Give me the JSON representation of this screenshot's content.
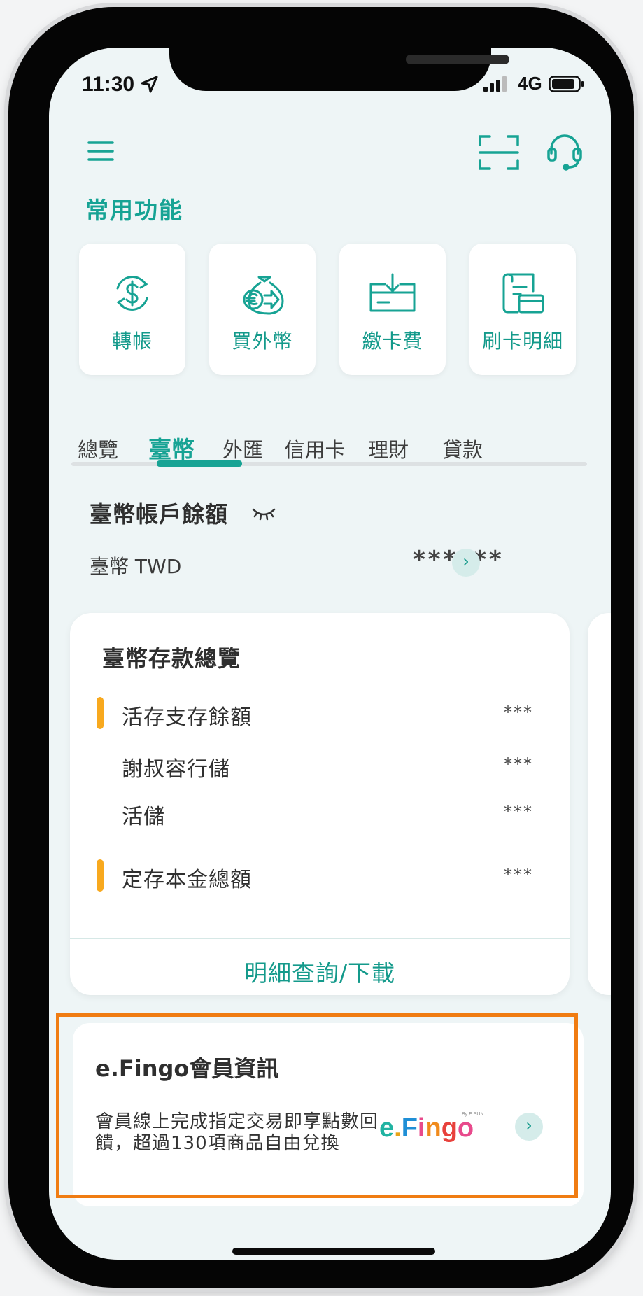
{
  "status_bar": {
    "time": "11:30",
    "network": "4G"
  },
  "header": {
    "menu_icon": "hamburger-menu-icon",
    "scan_icon": "scan-icon",
    "service_icon": "headset-icon"
  },
  "quick_access": {
    "title": "常用功能",
    "items": [
      {
        "label": "轉帳",
        "icon": "transfer-dollar-icon"
      },
      {
        "label": "買外幣",
        "icon": "currency-bag-icon"
      },
      {
        "label": "繳卡費",
        "icon": "card-payment-icon"
      },
      {
        "label": "刷卡明細",
        "icon": "card-statement-icon"
      }
    ]
  },
  "tabs": {
    "items": [
      "總覽",
      "臺幣",
      "外匯",
      "信用卡",
      "理財",
      "貸款"
    ],
    "active": "臺幣"
  },
  "balance": {
    "title": "臺幣帳戶餘額",
    "account_label": "臺幣 TWD",
    "masked_value": "******"
  },
  "deposit_card": {
    "title": "臺幣存款總覽",
    "rows": [
      {
        "label": "活存支存餘額",
        "value": "***"
      },
      {
        "label": "謝叔容行儲",
        "value": "***"
      },
      {
        "label": "活儲",
        "value": "***"
      },
      {
        "label": "定存本金總額",
        "value": "***"
      }
    ],
    "link": "明細查詢/下載"
  },
  "member": {
    "title": "e.Fingo會員資訊",
    "description": "會員線上完成指定交易即享點數回饋，超過130項商品自由兌換",
    "logo_text": "e.Fingo",
    "logo_sub": "By E.SUN Bank"
  },
  "colors": {
    "accent": "#17a394",
    "highlight": "#f07c12",
    "marker": "#f8a91e"
  }
}
